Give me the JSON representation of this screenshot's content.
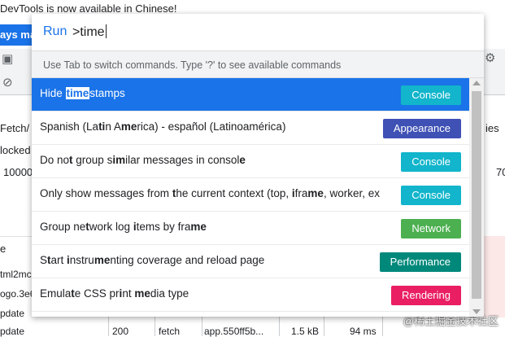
{
  "background": {
    "banner": "DevTools is now available in Chinese!",
    "banner_button": "ays ma",
    "left_col": [
      "Fetch/",
      "locked",
      "10000",
      "e",
      "tml2mc",
      "ogo.3e6",
      "pdate",
      "pdate"
    ],
    "right_col": [
      "ies",
      "70"
    ],
    "last_row": {
      "status": "200",
      "type": "fetch",
      "initiator": "app.550ff5b...",
      "size": "1.5 kB",
      "time": "94 ms"
    },
    "watermark": "@稀土掘金技术社区"
  },
  "command_menu": {
    "run_label": "Run",
    "query": ">time",
    "hint": "Use Tab to switch commands. Type '?' to see available commands",
    "items": [
      {
        "segments": [
          [
            "Hide ",
            false
          ],
          [
            "time",
            true
          ],
          [
            "stamps",
            false
          ]
        ],
        "badge": "Console",
        "color": "#12b5cb",
        "selected": true
      },
      {
        "segments": [
          [
            "Spanish (La",
            false
          ],
          [
            "ti",
            true
          ],
          [
            "n A",
            false
          ],
          [
            "me",
            true
          ],
          [
            "rica) - español (Latinoamérica)",
            false
          ]
        ],
        "badge": "Appearance",
        "color": "#3f51b5",
        "selected": false
      },
      {
        "segments": [
          [
            "Do no",
            false
          ],
          [
            "t",
            true
          ],
          [
            " group ",
            false
          ],
          [
            "s",
            false
          ],
          [
            "i",
            true
          ],
          [
            "m",
            true
          ],
          [
            "ilar messages in consol",
            false
          ],
          [
            "e",
            true
          ]
        ],
        "badge": "Console",
        "color": "#12b5cb",
        "selected": false
      },
      {
        "segments": [
          [
            "Only show messages from ",
            false
          ],
          [
            "t",
            true
          ],
          [
            "he current context (top, ",
            false
          ],
          [
            "i",
            true
          ],
          [
            "fra",
            false
          ],
          [
            "me",
            true
          ],
          [
            ", worker, ex",
            false
          ]
        ],
        "badge": "Console",
        "color": "#12b5cb",
        "selected": false
      },
      {
        "segments": [
          [
            "Group ne",
            false
          ],
          [
            "t",
            true
          ],
          [
            "work log ",
            false
          ],
          [
            "i",
            true
          ],
          [
            "tems by fra",
            false
          ],
          [
            "me",
            true
          ]
        ],
        "badge": "Network",
        "color": "#4caf50",
        "selected": false
      },
      {
        "segments": [
          [
            "S",
            false
          ],
          [
            "t",
            true
          ],
          [
            "art ",
            false
          ],
          [
            "i",
            true
          ],
          [
            "nstru",
            false
          ],
          [
            "me",
            true
          ],
          [
            "nting coverage and reload page",
            false
          ]
        ],
        "badge": "Performance",
        "color": "#00897b",
        "selected": false
      },
      {
        "segments": [
          [
            "Emula",
            false
          ],
          [
            "t",
            true
          ],
          [
            "e CSS pr",
            false
          ],
          [
            "i",
            true
          ],
          [
            "nt ",
            false
          ],
          [
            "me",
            true
          ],
          [
            "dia type",
            false
          ]
        ],
        "badge": "Rendering",
        "color": "#e91e63",
        "selected": false
      },
      {
        "segments": [
          [
            "",
            false
          ]
        ],
        "badge": "",
        "color": "#ffffff",
        "selected": false
      }
    ]
  }
}
